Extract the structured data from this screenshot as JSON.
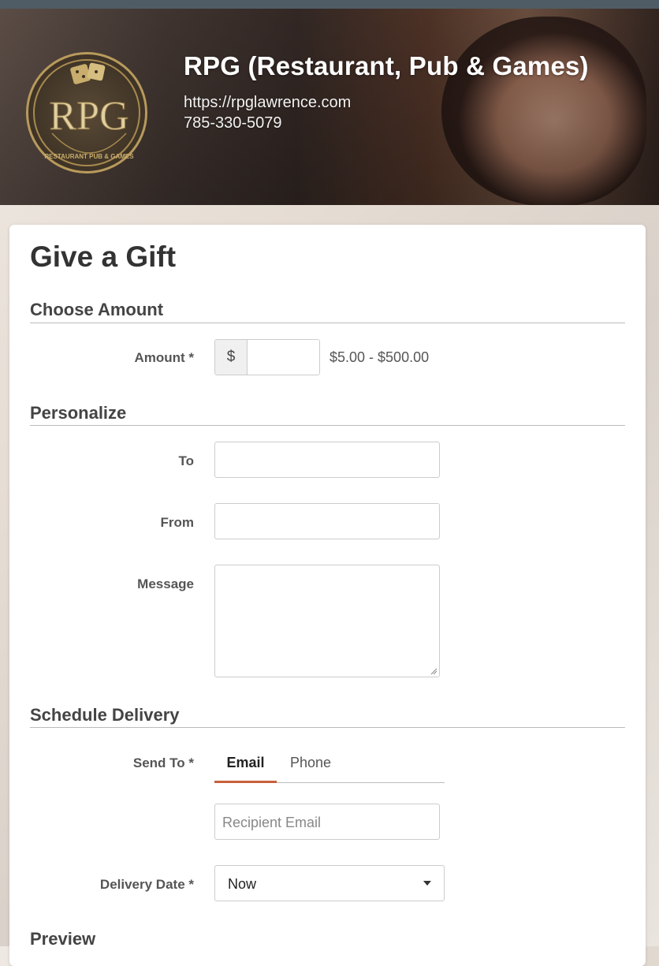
{
  "header": {
    "business_name": "RPG (Restaurant, Pub & Games)",
    "website": "https://rpglawrence.com",
    "phone": "785-330-5079",
    "logo": {
      "text": "RPG",
      "subtext": "RESTAURANT PUB & GAMES",
      "icon": "dice-logo"
    }
  },
  "form": {
    "title": "Give a Gift",
    "sections": {
      "amount": {
        "title": "Choose Amount",
        "amount_label": "Amount *",
        "currency_symbol": "$",
        "amount_value": "",
        "range_hint": "$5.00 - $500.00"
      },
      "personalize": {
        "title": "Personalize",
        "to_label": "To",
        "to_value": "",
        "from_label": "From",
        "from_value": "",
        "message_label": "Message",
        "message_value": ""
      },
      "delivery": {
        "title": "Schedule Delivery",
        "send_to_label": "Send To *",
        "tabs": [
          "Email",
          "Phone"
        ],
        "active_tab": "Email",
        "recipient_email_placeholder": "Recipient Email",
        "recipient_email_value": "",
        "delivery_date_label": "Delivery Date *",
        "delivery_date_value": "Now"
      },
      "preview": {
        "title": "Preview"
      }
    }
  },
  "colors": {
    "accent": "#c8603a",
    "topbar": "#4f5c66",
    "logo_gold": "#b89a5c"
  }
}
